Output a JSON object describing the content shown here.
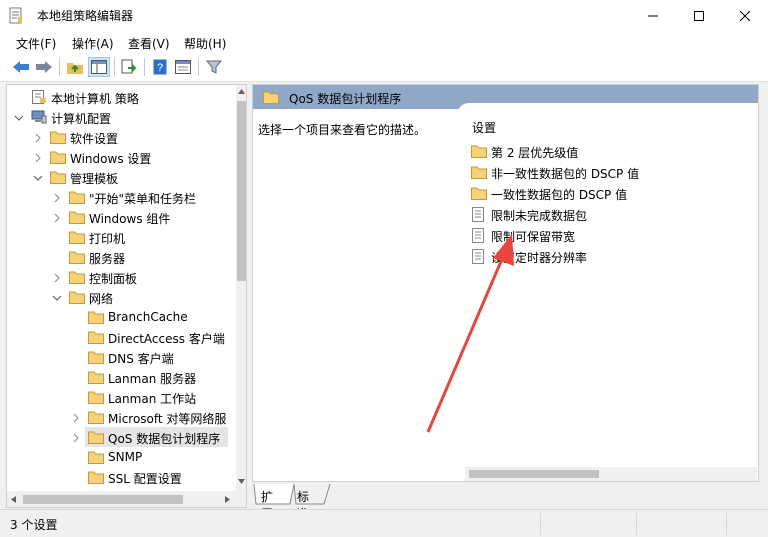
{
  "window": {
    "title": "本地组策略编辑器"
  },
  "menu": [
    "文件(F)",
    "操作(A)",
    "查看(V)",
    "帮助(H)"
  ],
  "tree": [
    {
      "label": "本地计算机 策略",
      "icon": "computer-policy-icon",
      "depth": 0,
      "expander": "none"
    },
    {
      "label": "计算机配置",
      "icon": "computer-icon",
      "depth": 0,
      "expander": "expanded"
    },
    {
      "label": "软件设置",
      "icon": "folder-icon",
      "depth": 1,
      "expander": "collapsed"
    },
    {
      "label": "Windows 设置",
      "icon": "folder-icon",
      "depth": 1,
      "expander": "collapsed"
    },
    {
      "label": "管理模板",
      "icon": "folder-icon",
      "depth": 1,
      "expander": "expanded"
    },
    {
      "label": "\"开始\"菜单和任务栏",
      "icon": "folder-icon",
      "depth": 2,
      "expander": "collapsed"
    },
    {
      "label": "Windows 组件",
      "icon": "folder-icon",
      "depth": 2,
      "expander": "collapsed"
    },
    {
      "label": "打印机",
      "icon": "folder-icon",
      "depth": 2,
      "expander": "none"
    },
    {
      "label": "服务器",
      "icon": "folder-icon",
      "depth": 2,
      "expander": "none"
    },
    {
      "label": "控制面板",
      "icon": "folder-icon",
      "depth": 2,
      "expander": "collapsed"
    },
    {
      "label": "网络",
      "icon": "folder-icon",
      "depth": 2,
      "expander": "expanded"
    },
    {
      "label": "BranchCache",
      "icon": "folder-icon",
      "depth": 3,
      "expander": "none"
    },
    {
      "label": "DirectAccess 客户端",
      "icon": "folder-icon",
      "depth": 3,
      "expander": "none"
    },
    {
      "label": "DNS 客户端",
      "icon": "folder-icon",
      "depth": 3,
      "expander": "none"
    },
    {
      "label": "Lanman 服务器",
      "icon": "folder-icon",
      "depth": 3,
      "expander": "none"
    },
    {
      "label": "Lanman 工作站",
      "icon": "folder-icon",
      "depth": 3,
      "expander": "none"
    },
    {
      "label": "Microsoft 对等网络服",
      "icon": "folder-icon",
      "depth": 3,
      "expander": "collapsed"
    },
    {
      "label": "QoS 数据包计划程序",
      "icon": "folder-icon",
      "depth": 3,
      "expander": "collapsed",
      "selected": true
    },
    {
      "label": "SNMP",
      "icon": "folder-icon",
      "depth": 3,
      "expander": "none"
    },
    {
      "label": "SSL 配置设置",
      "icon": "folder-icon",
      "depth": 3,
      "expander": "none"
    }
  ],
  "right": {
    "header": "QoS 数据包计划程序",
    "description": "选择一个项目来查看它的描述。",
    "column_header": "设置",
    "items": [
      {
        "label": "第 2 层优先级值",
        "type": "folder"
      },
      {
        "label": "非一致性数据包的 DSCP 值",
        "type": "folder"
      },
      {
        "label": "一致性数据包的 DSCP 值",
        "type": "folder"
      },
      {
        "label": "限制未完成数据包",
        "type": "setting"
      },
      {
        "label": "限制可保留带宽",
        "type": "setting"
      },
      {
        "label": "设置定时器分辨率",
        "type": "setting"
      }
    ]
  },
  "tabs": [
    "扩展",
    "标准"
  ],
  "status": {
    "text": "3 个设置"
  },
  "colors": {
    "header": "#8fa8c8",
    "folder": "#e8c05a",
    "arrow": "#e8453c"
  }
}
